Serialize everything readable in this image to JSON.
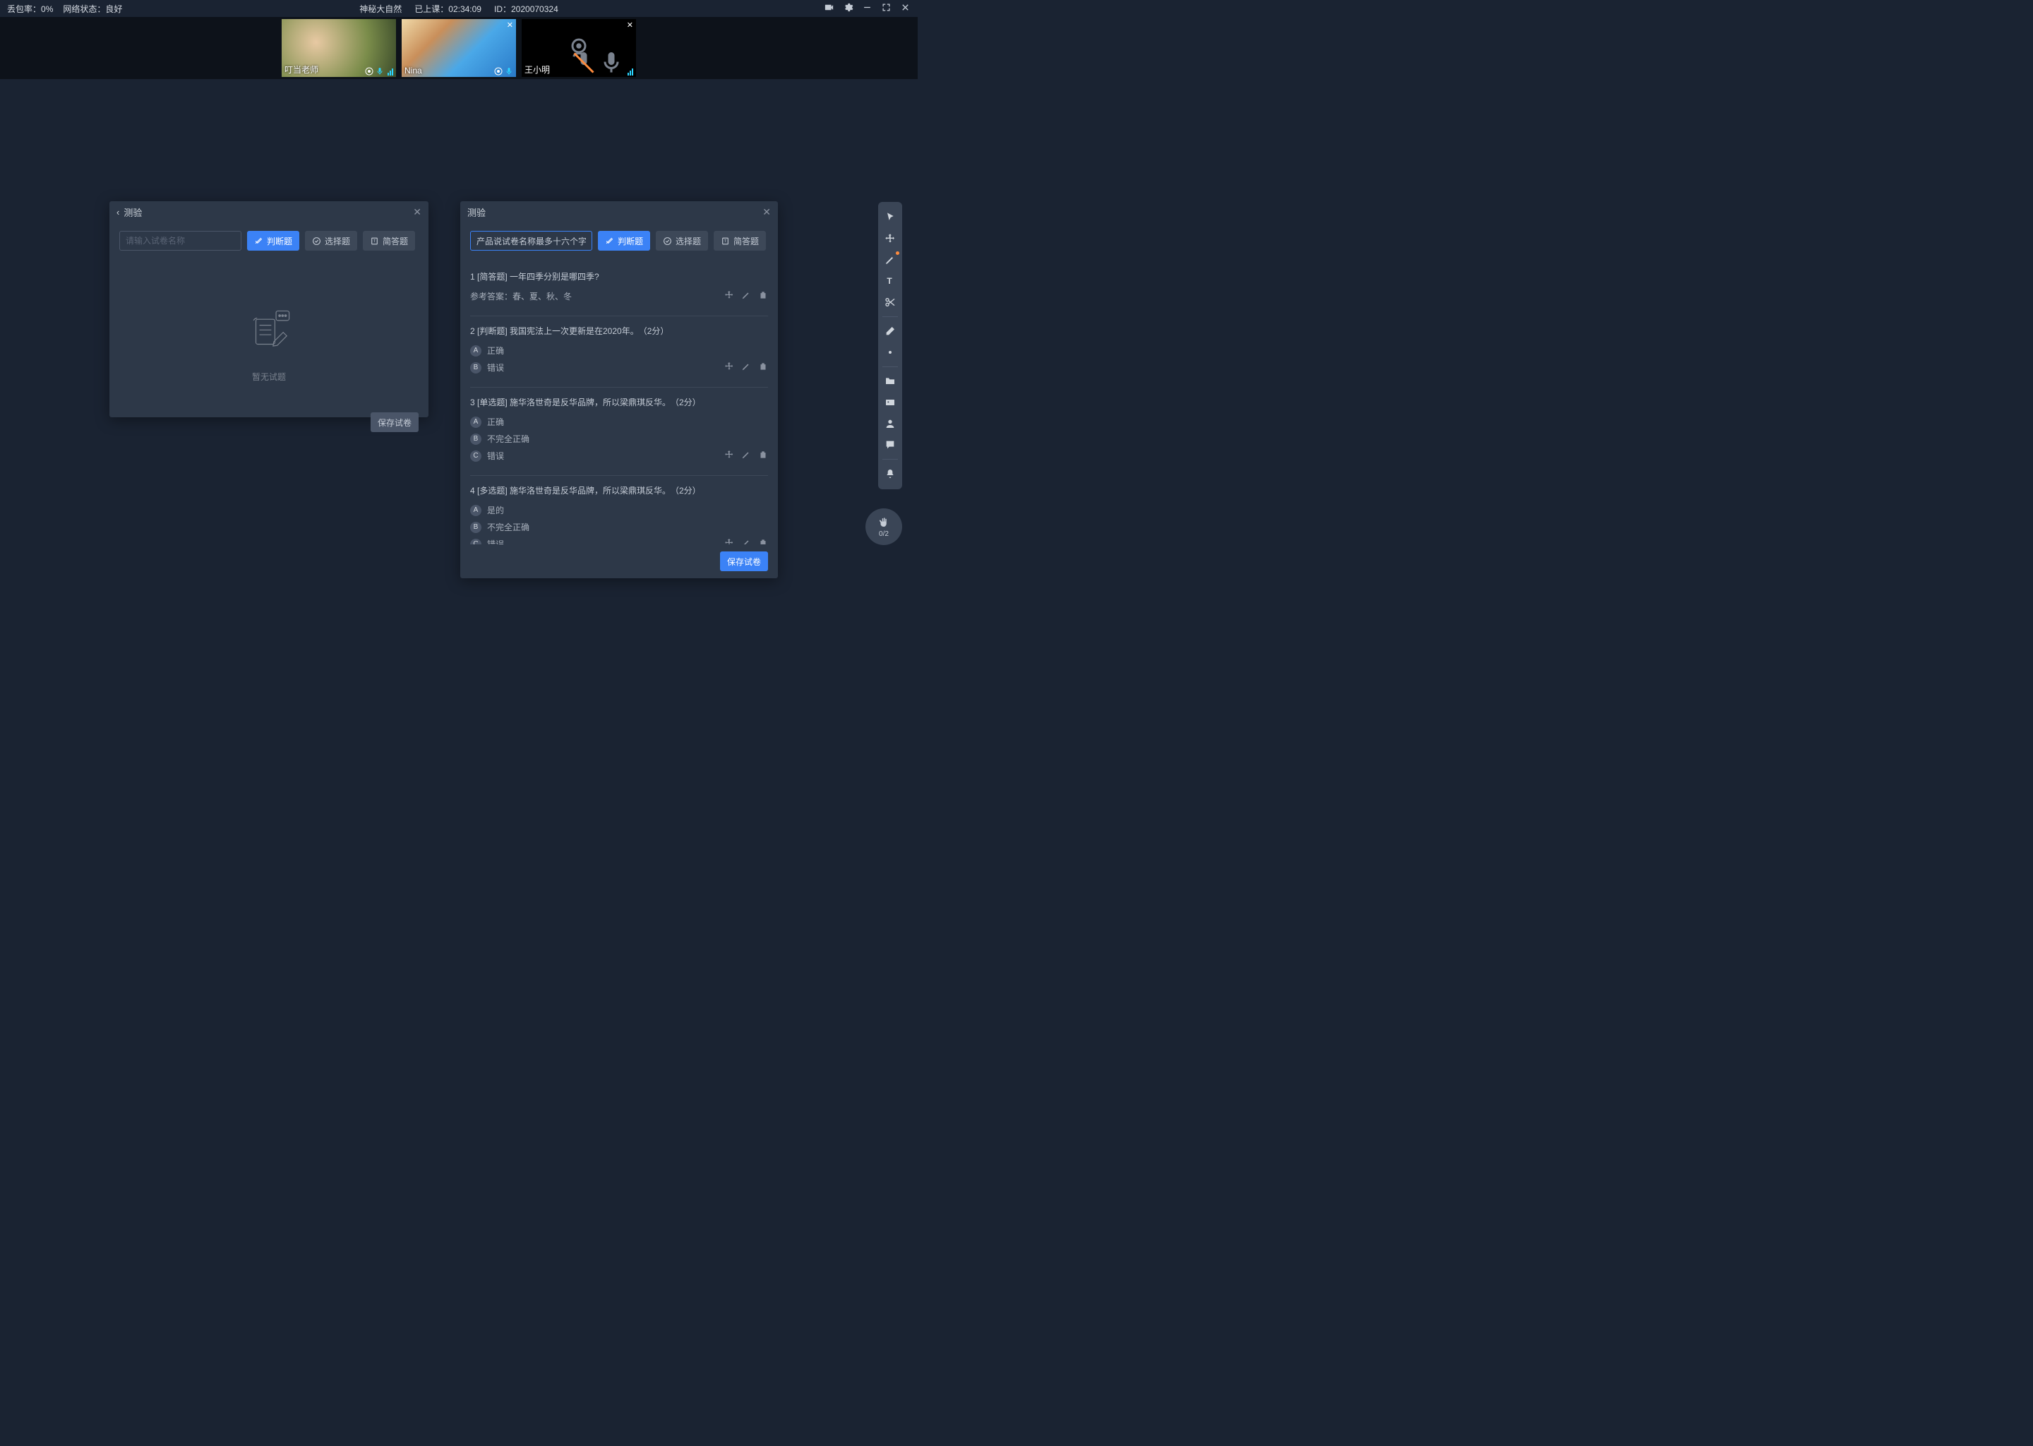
{
  "topbar": {
    "loss_label": "丢包率：",
    "loss_value": "0%",
    "net_label": "网络状态：",
    "net_value": "良好",
    "title": "神秘大自然",
    "duration_label": "已上课：",
    "duration_value": "02:34:09",
    "id_label": "ID：",
    "id_value": "2020070324"
  },
  "video": {
    "tiles": [
      {
        "name": "叮当老师",
        "camera_off": false,
        "muted": false,
        "closable": false
      },
      {
        "name": "Nina",
        "camera_off": false,
        "muted": false,
        "closable": true
      },
      {
        "name": "王小明",
        "camera_off": true,
        "muted": true,
        "closable": true
      }
    ]
  },
  "panel_left": {
    "title": "测验",
    "name_placeholder": "请输入试卷名称",
    "tabs": {
      "judge": "判断题",
      "choice": "选择题",
      "short": "简答题"
    },
    "empty_text": "暂无试题",
    "save": "保存试卷"
  },
  "panel_right": {
    "title": "测验",
    "name_value": "产品说试卷名称最多十六个字",
    "tabs": {
      "judge": "判断题",
      "choice": "选择题",
      "short": "简答题"
    },
    "save": "保存试卷",
    "answer_prefix": "参考答案：",
    "questions": [
      {
        "idx": "1",
        "type": "[简答题]",
        "text": "一年四季分别是哪四季?",
        "answer": "春、夏、秋、冬",
        "options": []
      },
      {
        "idx": "2",
        "type": "[判断题]",
        "text": "我国宪法上一次更新是在2020年。",
        "points": "（2分）",
        "options": [
          {
            "k": "A",
            "t": "正确"
          },
          {
            "k": "B",
            "t": "错误"
          }
        ]
      },
      {
        "idx": "3",
        "type": "[单选题]",
        "text": "施华洛世奇是反华品牌，所以梁鼎琪反华。",
        "points": "（2分）",
        "options": [
          {
            "k": "A",
            "t": "正确"
          },
          {
            "k": "B",
            "t": "不完全正确"
          },
          {
            "k": "C",
            "t": "错误"
          }
        ]
      },
      {
        "idx": "4",
        "type": "[多选题]",
        "text": "施华洛世奇是反华品牌，所以梁鼎琪反华。",
        "points": "（2分）",
        "options": [
          {
            "k": "A",
            "t": "是的"
          },
          {
            "k": "B",
            "t": "不完全正确"
          },
          {
            "k": "C",
            "t": "错误"
          }
        ]
      }
    ]
  },
  "hand": {
    "count": "0/2"
  }
}
